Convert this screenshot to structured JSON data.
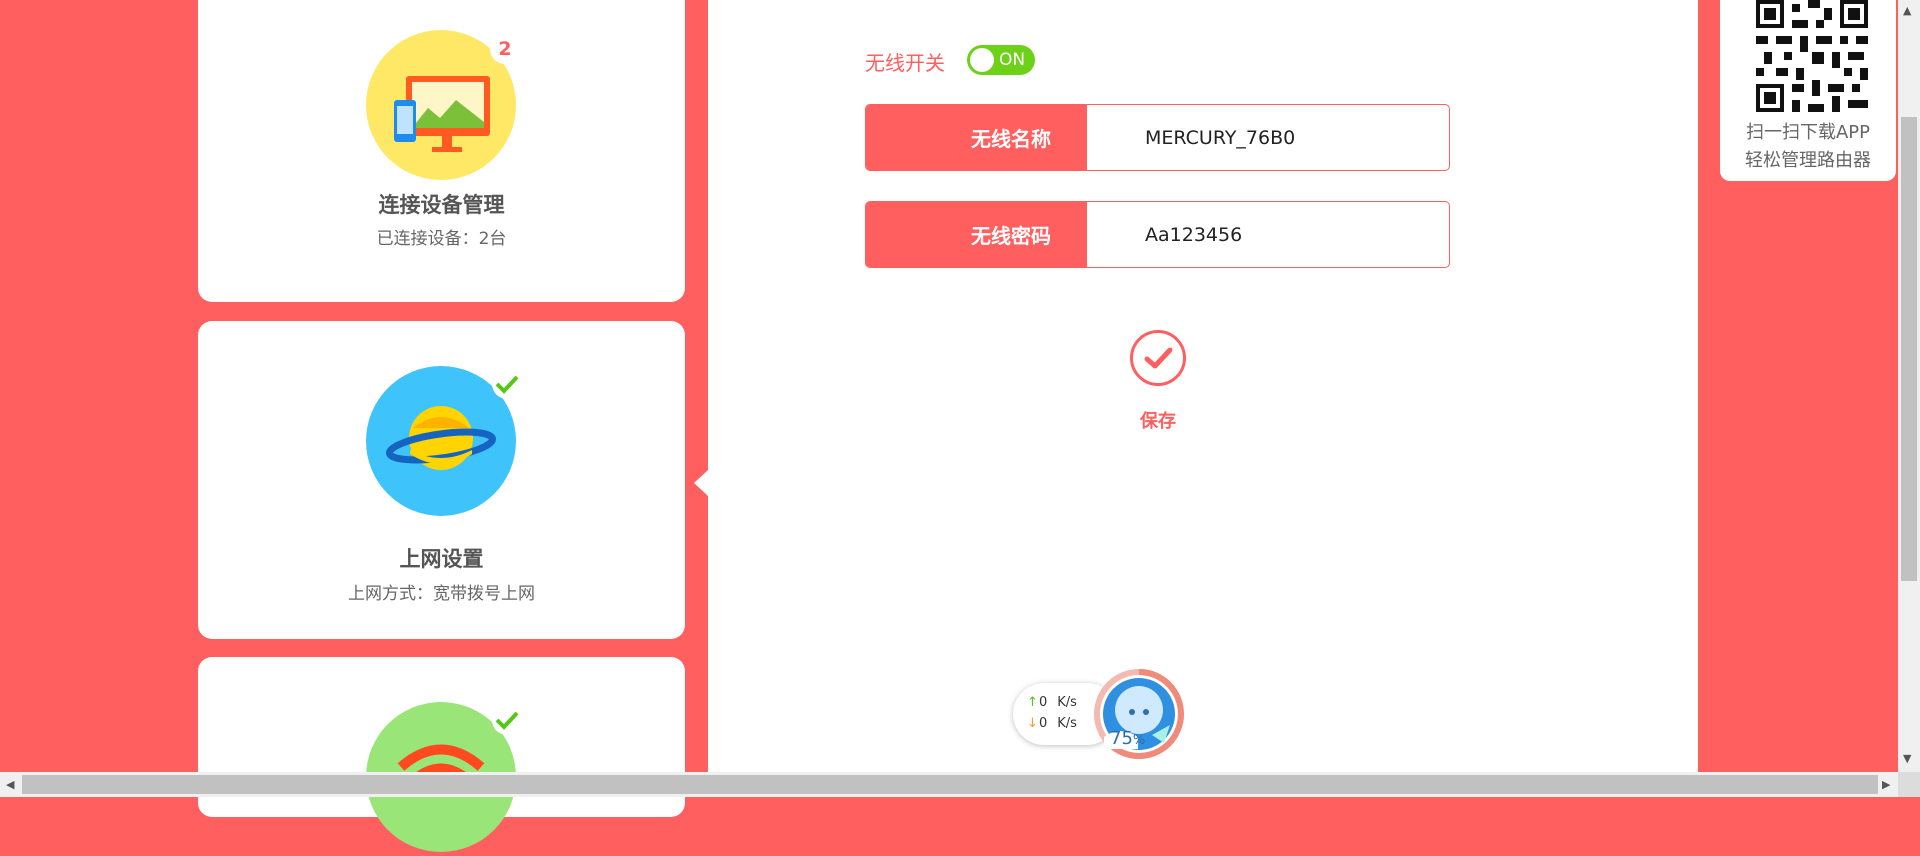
{
  "cards": [
    {
      "title": "连接设备管理",
      "subtitle": "已连接设备：2台",
      "badge": "2",
      "icon": "devices-icon"
    },
    {
      "title": "上网设置",
      "subtitle": "上网方式：宽带拨号上网",
      "badge_icon": "check-icon",
      "icon": "planet-icon"
    },
    {
      "title": "",
      "subtitle": "",
      "badge_icon": "check-icon",
      "icon": "wifi-icon"
    }
  ],
  "wireless": {
    "switch_label": "无线开关",
    "toggle_text": "ON",
    "ssid_label": "无线名称",
    "ssid_value": "MERCURY_76B0",
    "password_label": "无线密码",
    "password_value": "Aa123456"
  },
  "save": {
    "label": "保存",
    "icon": "check-icon"
  },
  "qr": {
    "line1": "扫一扫下载APP",
    "line2": "轻松管理路由器"
  },
  "speed": {
    "upload": "0",
    "download": "0",
    "unit": "K/s"
  },
  "assistant": {
    "load": "75",
    "pct_sign": "%"
  },
  "colors": {
    "accent": "#ff5f5f",
    "toggle_on": "#6dd117",
    "check": "#55c716"
  }
}
